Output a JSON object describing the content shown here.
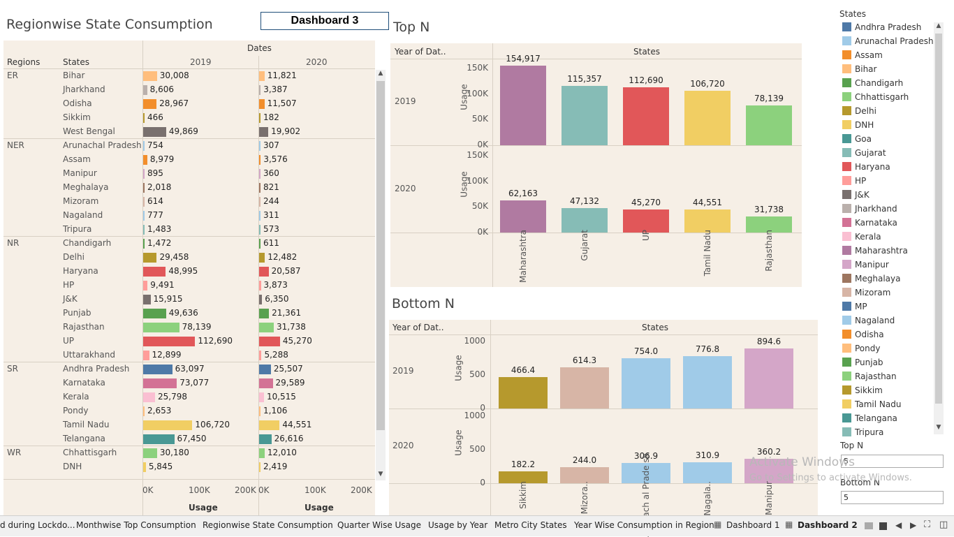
{
  "left": {
    "title": "Regionwise State Consumption",
    "col_regions": "Regions",
    "col_states": "States",
    "col_dates": "Dates",
    "year_2019": "2019",
    "year_2020": "2020",
    "axis_ticks": [
      "0K",
      "100K",
      "200K"
    ],
    "axis_label": "Usage",
    "max": 250000,
    "rows": [
      {
        "region": "ER",
        "state": "Bihar",
        "v2019": 30008,
        "l2019": "30,008",
        "v2020": 11821,
        "l2020": "11,821",
        "color": "#ffbe7d"
      },
      {
        "region": "",
        "state": "Jharkhand",
        "v2019": 8606,
        "l2019": "8,606",
        "v2020": 3387,
        "l2020": "3,387",
        "color": "#bab0ac"
      },
      {
        "region": "",
        "state": "Odisha",
        "v2019": 28967,
        "l2019": "28,967",
        "v2020": 11507,
        "l2020": "11,507",
        "color": "#f28e2b"
      },
      {
        "region": "",
        "state": "Sikkim",
        "v2019": 466,
        "l2019": "466",
        "v2020": 182,
        "l2020": "182",
        "color": "#b6992d"
      },
      {
        "region": "",
        "state": "West Bengal",
        "v2019": 49869,
        "l2019": "49,869",
        "v2020": 19902,
        "l2020": "19,902",
        "color": "#79706e"
      },
      {
        "region": "NER",
        "state": "Arunachal Pradesh",
        "v2019": 754,
        "l2019": "754",
        "v2020": 307,
        "l2020": "307",
        "color": "#a0cbe8"
      },
      {
        "region": "",
        "state": "Assam",
        "v2019": 8979,
        "l2019": "8,979",
        "v2020": 3576,
        "l2020": "3,576",
        "color": "#f28e2b"
      },
      {
        "region": "",
        "state": "Manipur",
        "v2019": 895,
        "l2019": "895",
        "v2020": 360,
        "l2020": "360",
        "color": "#d4a6c8"
      },
      {
        "region": "",
        "state": "Meghalaya",
        "v2019": 2018,
        "l2019": "2,018",
        "v2020": 821,
        "l2020": "821",
        "color": "#9d7660"
      },
      {
        "region": "",
        "state": "Mizoram",
        "v2019": 614,
        "l2019": "614",
        "v2020": 244,
        "l2020": "244",
        "color": "#d7b5a6"
      },
      {
        "region": "",
        "state": "Nagaland",
        "v2019": 777,
        "l2019": "777",
        "v2020": 311,
        "l2020": "311",
        "color": "#a0cbe8"
      },
      {
        "region": "",
        "state": "Tripura",
        "v2019": 1483,
        "l2019": "1,483",
        "v2020": 573,
        "l2020": "573",
        "color": "#86bcb6"
      },
      {
        "region": "NR",
        "state": "Chandigarh",
        "v2019": 1472,
        "l2019": "1,472",
        "v2020": 611,
        "l2020": "611",
        "color": "#59a14f"
      },
      {
        "region": "",
        "state": "Delhi",
        "v2019": 29458,
        "l2019": "29,458",
        "v2020": 12482,
        "l2020": "12,482",
        "color": "#b6992d"
      },
      {
        "region": "",
        "state": "Haryana",
        "v2019": 48995,
        "l2019": "48,995",
        "v2020": 20587,
        "l2020": "20,587",
        "color": "#e15759"
      },
      {
        "region": "",
        "state": "HP",
        "v2019": 9491,
        "l2019": "9,491",
        "v2020": 3873,
        "l2020": "3,873",
        "color": "#ff9d9a"
      },
      {
        "region": "",
        "state": "J&K",
        "v2019": 15915,
        "l2019": "15,915",
        "v2020": 6350,
        "l2020": "6,350",
        "color": "#79706e"
      },
      {
        "region": "",
        "state": "Punjab",
        "v2019": 49636,
        "l2019": "49,636",
        "v2020": 21361,
        "l2020": "21,361",
        "color": "#59a14f"
      },
      {
        "region": "",
        "state": "Rajasthan",
        "v2019": 78139,
        "l2019": "78,139",
        "v2020": 31738,
        "l2020": "31,738",
        "color": "#8cd17d"
      },
      {
        "region": "",
        "state": "UP",
        "v2019": 112690,
        "l2019": "112,690",
        "v2020": 45270,
        "l2020": "45,270",
        "color": "#e15759"
      },
      {
        "region": "",
        "state": "Uttarakhand",
        "v2019": 12899,
        "l2019": "12,899",
        "v2020": 5288,
        "l2020": "5,288",
        "color": "#ff9d9a"
      },
      {
        "region": "SR",
        "state": "Andhra Pradesh",
        "v2019": 63097,
        "l2019": "63,097",
        "v2020": 25507,
        "l2020": "25,507",
        "color": "#4e79a7"
      },
      {
        "region": "",
        "state": "Karnataka",
        "v2019": 73077,
        "l2019": "73,077",
        "v2020": 29589,
        "l2020": "29,589",
        "color": "#d37295"
      },
      {
        "region": "",
        "state": "Kerala",
        "v2019": 25798,
        "l2019": "25,798",
        "v2020": 10515,
        "l2020": "10,515",
        "color": "#fabfd2"
      },
      {
        "region": "",
        "state": "Pondy",
        "v2019": 2653,
        "l2019": "2,653",
        "v2020": 1106,
        "l2020": "1,106",
        "color": "#ffbe7d"
      },
      {
        "region": "",
        "state": "Tamil Nadu",
        "v2019": 106720,
        "l2019": "106,720",
        "v2020": 44551,
        "l2020": "44,551",
        "color": "#f1ce63"
      },
      {
        "region": "",
        "state": "Telangana",
        "v2019": 67450,
        "l2019": "67,450",
        "v2020": 26616,
        "l2020": "26,616",
        "color": "#499894"
      },
      {
        "region": "WR",
        "state": "Chhattisgarh",
        "v2019": 30180,
        "l2019": "30,180",
        "v2020": 12010,
        "l2020": "12,010",
        "color": "#8cd17d"
      },
      {
        "region": "",
        "state": "DNH",
        "v2019": 5845,
        "l2019": "5,845",
        "v2020": 2419,
        "l2020": "2,419",
        "color": "#f1ce63"
      }
    ]
  },
  "dashboard_box": "Dashboard 3",
  "topn": {
    "title": "Top N",
    "hdr_year": "Year of Dat..",
    "hdr_states": "States",
    "y_label": "Usage",
    "rows": [
      "2019",
      "2020"
    ],
    "ticks": [
      "150K",
      "100K",
      "50K",
      "0K"
    ],
    "max": 150000,
    "categories": [
      "Maharashtra",
      "Gujarat",
      "UP",
      "Tamil Nadu",
      "Rajasthan"
    ],
    "colors": [
      "#b07aa1",
      "#86bcb6",
      "#e15759",
      "#f1ce63",
      "#8cd17d"
    ],
    "v2019": [
      154917,
      115357,
      112690,
      106720,
      78139
    ],
    "l2019": [
      "154,917",
      "115,357",
      "112,690",
      "106,720",
      "78,139"
    ],
    "v2020": [
      62163,
      47132,
      45270,
      44551,
      31738
    ],
    "l2020": [
      "62,163",
      "47,132",
      "45,270",
      "44,551",
      "31,738"
    ]
  },
  "bottomn": {
    "title": "Bottom N",
    "hdr_year": "Year of Dat..",
    "hdr_states": "States",
    "y_label": "Usage",
    "rows": [
      "2019",
      "2020"
    ],
    "ticks": [
      "1000",
      "500",
      "0"
    ],
    "max": 1000,
    "categories": [
      "Sikkim",
      "Mizora..",
      "Arunach al Prade sh",
      "Nagala..",
      "Manipur"
    ],
    "colors": [
      "#b6992d",
      "#d7b5a6",
      "#a0cbe8",
      "#a0cbe8",
      "#d4a6c8"
    ],
    "v2019": [
      466.4,
      614.3,
      754.0,
      776.8,
      894.6
    ],
    "l2019": [
      "466.4",
      "614.3",
      "754.0",
      "776.8",
      "894.6"
    ],
    "v2020": [
      182.2,
      244.0,
      306.9,
      310.9,
      360.2
    ],
    "l2020": [
      "182.2",
      "244.0",
      "306.9",
      "310.9",
      "360.2"
    ]
  },
  "legend": {
    "title": "States",
    "items": [
      {
        "name": "Andhra Pradesh",
        "color": "#4e79a7"
      },
      {
        "name": "Arunachal Pradesh",
        "color": "#a0cbe8"
      },
      {
        "name": "Assam",
        "color": "#f28e2b"
      },
      {
        "name": "Bihar",
        "color": "#ffbe7d"
      },
      {
        "name": "Chandigarh",
        "color": "#59a14f"
      },
      {
        "name": "Chhattisgarh",
        "color": "#8cd17d"
      },
      {
        "name": "Delhi",
        "color": "#b6992d"
      },
      {
        "name": "DNH",
        "color": "#f1ce63"
      },
      {
        "name": "Goa",
        "color": "#499894"
      },
      {
        "name": "Gujarat",
        "color": "#86bcb6"
      },
      {
        "name": "Haryana",
        "color": "#e15759"
      },
      {
        "name": "HP",
        "color": "#ff9d9a"
      },
      {
        "name": "J&K",
        "color": "#79706e"
      },
      {
        "name": "Jharkhand",
        "color": "#bab0ac"
      },
      {
        "name": "Karnataka",
        "color": "#d37295"
      },
      {
        "name": "Kerala",
        "color": "#fabfd2"
      },
      {
        "name": "Maharashtra",
        "color": "#b07aa1"
      },
      {
        "name": "Manipur",
        "color": "#d4a6c8"
      },
      {
        "name": "Meghalaya",
        "color": "#9d7660"
      },
      {
        "name": "Mizoram",
        "color": "#d7b5a6"
      },
      {
        "name": "MP",
        "color": "#4e79a7"
      },
      {
        "name": "Nagaland",
        "color": "#a0cbe8"
      },
      {
        "name": "Odisha",
        "color": "#f28e2b"
      },
      {
        "name": "Pondy",
        "color": "#ffbe7d"
      },
      {
        "name": "Punjab",
        "color": "#59a14f"
      },
      {
        "name": "Rajasthan",
        "color": "#8cd17d"
      },
      {
        "name": "Sikkim",
        "color": "#b6992d"
      },
      {
        "name": "Tamil Nadu",
        "color": "#f1ce63"
      },
      {
        "name": "Telangana",
        "color": "#499894"
      },
      {
        "name": "Tripura",
        "color": "#86bcb6"
      }
    ]
  },
  "params": {
    "topn_label": "Top N",
    "topn_value": "5",
    "bottomn_label": "Bottom N",
    "bottomn_value": "5"
  },
  "watermark": {
    "line1": "Activate Windows",
    "line2": "Go to Settings to activate Windows."
  },
  "tabs": [
    "d during Lockdo...",
    "Monthwise Top Consumption",
    "Regionwise State Consumption",
    "Quarter Wise Usage",
    "Usage by Year",
    "Metro City States",
    "Year Wise Consumption in Region",
    "Dashboard 1",
    "Dashboard 2"
  ],
  "chart_data": [
    {
      "type": "bar",
      "title": "Regionwise State Consumption",
      "xlabel": "Usage",
      "categories": [
        "Bihar",
        "Jharkhand",
        "Odisha",
        "Sikkim",
        "West Bengal",
        "Arunachal Pradesh",
        "Assam",
        "Manipur",
        "Meghalaya",
        "Mizoram",
        "Nagaland",
        "Tripura",
        "Chandigarh",
        "Delhi",
        "Haryana",
        "HP",
        "J&K",
        "Punjab",
        "Rajasthan",
        "UP",
        "Uttarakhand",
        "Andhra Pradesh",
        "Karnataka",
        "Kerala",
        "Pondy",
        "Tamil Nadu",
        "Telangana",
        "Chhattisgarh",
        "DNH"
      ],
      "series": [
        {
          "name": "2019",
          "values": [
            30008,
            8606,
            28967,
            466,
            49869,
            754,
            8979,
            895,
            2018,
            614,
            777,
            1483,
            1472,
            29458,
            48995,
            9491,
            15915,
            49636,
            78139,
            112690,
            12899,
            63097,
            73077,
            25798,
            2653,
            106720,
            67450,
            30180,
            5845
          ]
        },
        {
          "name": "2020",
          "values": [
            11821,
            3387,
            11507,
            182,
            19902,
            307,
            3576,
            360,
            821,
            244,
            311,
            573,
            611,
            12482,
            20587,
            3873,
            6350,
            21361,
            31738,
            45270,
            5288,
            25507,
            29589,
            10515,
            1106,
            44551,
            26616,
            12010,
            2419
          ]
        }
      ]
    },
    {
      "type": "bar",
      "title": "Top N",
      "ylabel": "Usage",
      "categories": [
        "Maharashtra",
        "Gujarat",
        "UP",
        "Tamil Nadu",
        "Rajasthan"
      ],
      "series": [
        {
          "name": "2019",
          "values": [
            154917,
            115357,
            112690,
            106720,
            78139
          ]
        },
        {
          "name": "2020",
          "values": [
            62163,
            47132,
            45270,
            44551,
            31738
          ]
        }
      ],
      "ylim": [
        0,
        150000
      ]
    },
    {
      "type": "bar",
      "title": "Bottom N",
      "ylabel": "Usage",
      "categories": [
        "Sikkim",
        "Mizoram",
        "Arunachal Pradesh",
        "Nagaland",
        "Manipur"
      ],
      "series": [
        {
          "name": "2019",
          "values": [
            466.4,
            614.3,
            754.0,
            776.8,
            894.6
          ]
        },
        {
          "name": "2020",
          "values": [
            182.2,
            244.0,
            306.9,
            310.9,
            360.2
          ]
        }
      ],
      "ylim": [
        0,
        1000
      ]
    }
  ]
}
